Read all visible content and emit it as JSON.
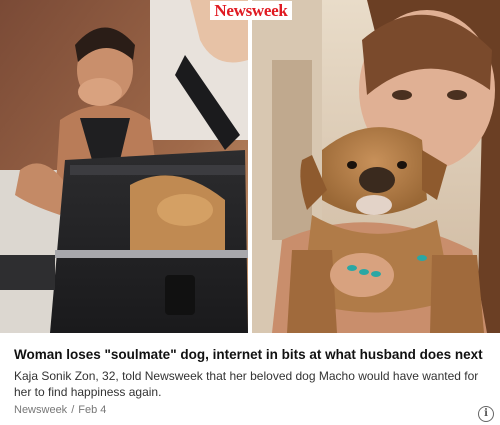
{
  "brand": {
    "name": "Newsweek",
    "color": "#e01a22"
  },
  "article": {
    "headline": "Woman loses \"soulmate\" dog, internet in bits at what husband does next",
    "summary": "Kaja Sonik Zon, 32, told Newsweek that her beloved dog Macho would have wanted for her to find happiness again.",
    "source": "Newsweek",
    "date": "Feb 4",
    "separator": "/"
  },
  "icons": {
    "info": "info-icon",
    "info_glyph": "i"
  }
}
